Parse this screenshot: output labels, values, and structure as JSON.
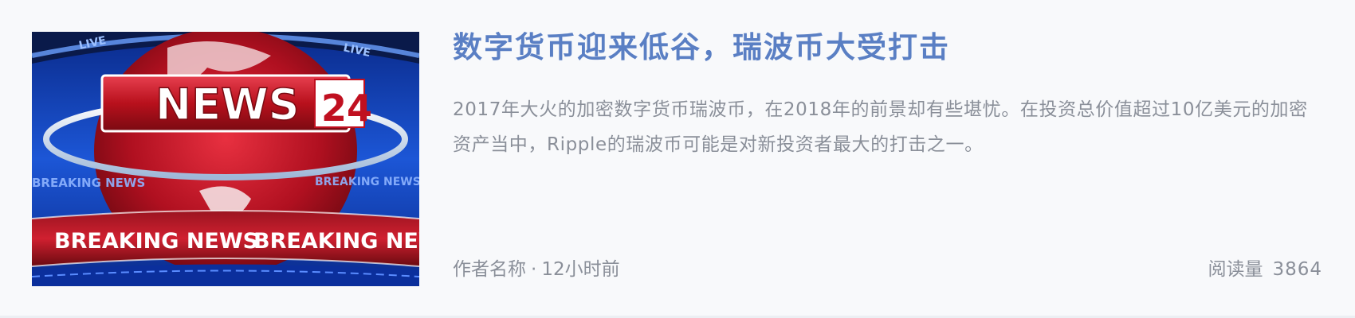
{
  "article": {
    "thumbnail": {
      "news_text": "NEWS",
      "badge_number": "24",
      "ticker_text": "BREAKING NEWS",
      "live_text": "LIVE",
      "colors": {
        "red": "#c4141f",
        "blue": "#1a4fd0",
        "white": "#ffffff"
      }
    },
    "title": "数字货币迎来低谷，瑞波币大受打击",
    "summary": "2017年大火的加密数字货币瑞波币，在2018年的前景却有些堪忧。在投资总价值超过10亿美元的加密资产当中，Ripple的瑞波币可能是对新投资者最大的打击之一。",
    "author": "作者名称",
    "separator": "·",
    "time": "12小时前",
    "reads_label": "阅读量",
    "reads_count": "3864"
  },
  "colors": {
    "title": "#5a7fc4",
    "text": "#8a8f99",
    "background": "#f8f9fb"
  }
}
